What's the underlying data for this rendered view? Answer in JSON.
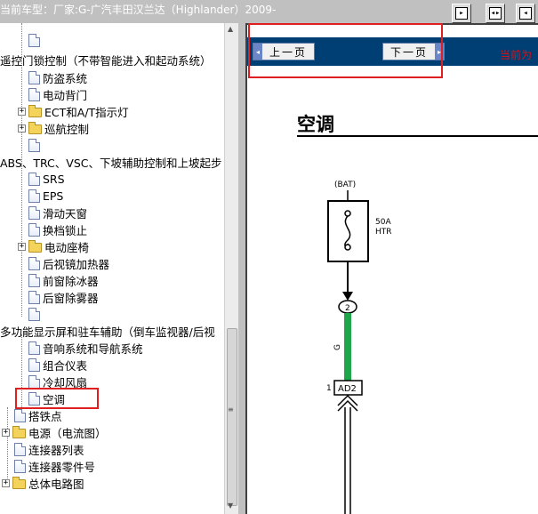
{
  "header": {
    "vehicle_label": "当前车型：厂家:G-广汽丰田汉兰达（Highlander）2009-",
    "buttons": [
      {
        "name": "forward-icon",
        "glyph": "▸"
      },
      {
        "name": "expand-icon",
        "glyph": "◂▸"
      },
      {
        "name": "back-icon",
        "glyph": "◂"
      }
    ]
  },
  "tree": {
    "items": [
      {
        "label": "",
        "type": "doc"
      },
      {
        "label": "遥控门锁控制（不带智能进入和起动系统）",
        "type": "text"
      },
      {
        "label": "防盗系统",
        "type": "doc"
      },
      {
        "label": "电动背门",
        "type": "doc"
      },
      {
        "label": "ECT和A/T指示灯",
        "type": "folder"
      },
      {
        "label": "巡航控制",
        "type": "folder"
      },
      {
        "label": "",
        "type": "doc"
      },
      {
        "label": "ABS、TRC、VSC、下坡辅助控制和上坡起步",
        "type": "text"
      },
      {
        "label": "SRS",
        "type": "doc"
      },
      {
        "label": "EPS",
        "type": "doc"
      },
      {
        "label": "滑动天窗",
        "type": "doc"
      },
      {
        "label": "换档锁止",
        "type": "doc"
      },
      {
        "label": "电动座椅",
        "type": "folder"
      },
      {
        "label": "后视镜加热器",
        "type": "doc"
      },
      {
        "label": "前窗除冰器",
        "type": "doc"
      },
      {
        "label": "后窗除雾器",
        "type": "doc"
      },
      {
        "label": "",
        "type": "doc"
      },
      {
        "label": "多功能显示屏和驻车辅助（倒车监视器/后视",
        "type": "text"
      },
      {
        "label": "音响系统和导航系统",
        "type": "doc"
      },
      {
        "label": "组合仪表",
        "type": "doc"
      },
      {
        "label": "冷却风扇",
        "type": "doc"
      },
      {
        "label": "空调",
        "type": "doc"
      },
      {
        "label": "搭铁点",
        "type": "doc"
      },
      {
        "label": "电源（电流图）",
        "type": "folder"
      },
      {
        "label": "连接器列表",
        "type": "doc"
      },
      {
        "label": "连接器零件号",
        "type": "doc"
      },
      {
        "label": "总体电路图",
        "type": "folder"
      }
    ]
  },
  "navigation": {
    "prev_label": "上一页",
    "next_label": "下一页",
    "current_label": "当前为"
  },
  "document": {
    "title": "空调",
    "bat_label": "(BAT)",
    "fuse_rating": "50A",
    "fuse_name": "HTR",
    "junction_number": "2",
    "wire_color": "G",
    "connector_pin": "1",
    "connector_name": "AD2"
  },
  "colors": {
    "navbar": "#003f73",
    "wire_green": "#1fa64a",
    "highlight_red": "#e02020"
  }
}
